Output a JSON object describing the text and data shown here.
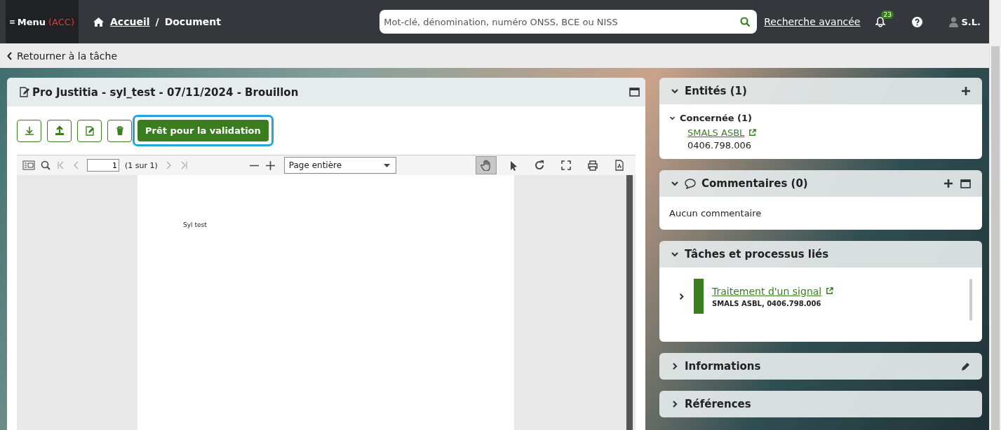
{
  "topbar": {
    "menu": {
      "label": "Menu",
      "env": "(ACC)"
    },
    "breadcrumb": [
      {
        "label": "Accueil",
        "link": true
      },
      {
        "label": "Document",
        "link": false
      }
    ],
    "breadcrumb_separator": "/",
    "search": {
      "placeholder": "Mot-clé, dénomination, numéro ONSS, BCE ou NISS"
    },
    "advanced_search": "Recherche avancée",
    "notifications": "23",
    "user": "S.L."
  },
  "back_link": "Retourner à la tâche",
  "document": {
    "title": "Pro Justitia - syl_test - 07/11/2024 - Brouillon",
    "actions": [
      {
        "kind": "download"
      },
      {
        "kind": "upload"
      },
      {
        "kind": "edit"
      },
      {
        "kind": "delete"
      }
    ],
    "primary_button": {
      "label": "Prêt pour la validation",
      "focused": true
    },
    "viewer": {
      "page": "1",
      "page_count": "(1 sur 1)",
      "zoom": "Page entière",
      "tools": [
        {
          "kind": "hand",
          "selected": true
        },
        {
          "kind": "pointer",
          "selected": false
        },
        {
          "kind": "rotate",
          "selected": false
        },
        {
          "kind": "fullscreen",
          "selected": false
        },
        {
          "kind": "print",
          "selected": false
        },
        {
          "kind": "pdf",
          "selected": false
        }
      ],
      "page_text": "Syl test"
    }
  },
  "panels": [
    {
      "kind": "entities",
      "title": "Entités (1)",
      "expanded": true,
      "groups": [
        {
          "label": "Concernée (1)",
          "expanded": true,
          "items": [
            {
              "name": "SMALS ASBL",
              "number": "0406.798.006"
            }
          ]
        }
      ]
    },
    {
      "kind": "comments",
      "title": "Commentaires (0)",
      "expanded": true,
      "text": "Aucun commentaire"
    },
    {
      "kind": "tasks",
      "title": "Tâches et processus liés",
      "expanded": true,
      "items": [
        {
          "title": "Traitement d'un signal",
          "subtitle": "SMALS ASBL, 0406.798.006",
          "color": "#3a7d1e",
          "expanded": false
        }
      ]
    },
    {
      "kind": "information",
      "title": "Informations",
      "expanded": false
    },
    {
      "kind": "references",
      "title": "Références",
      "expanded": false
    }
  ]
}
